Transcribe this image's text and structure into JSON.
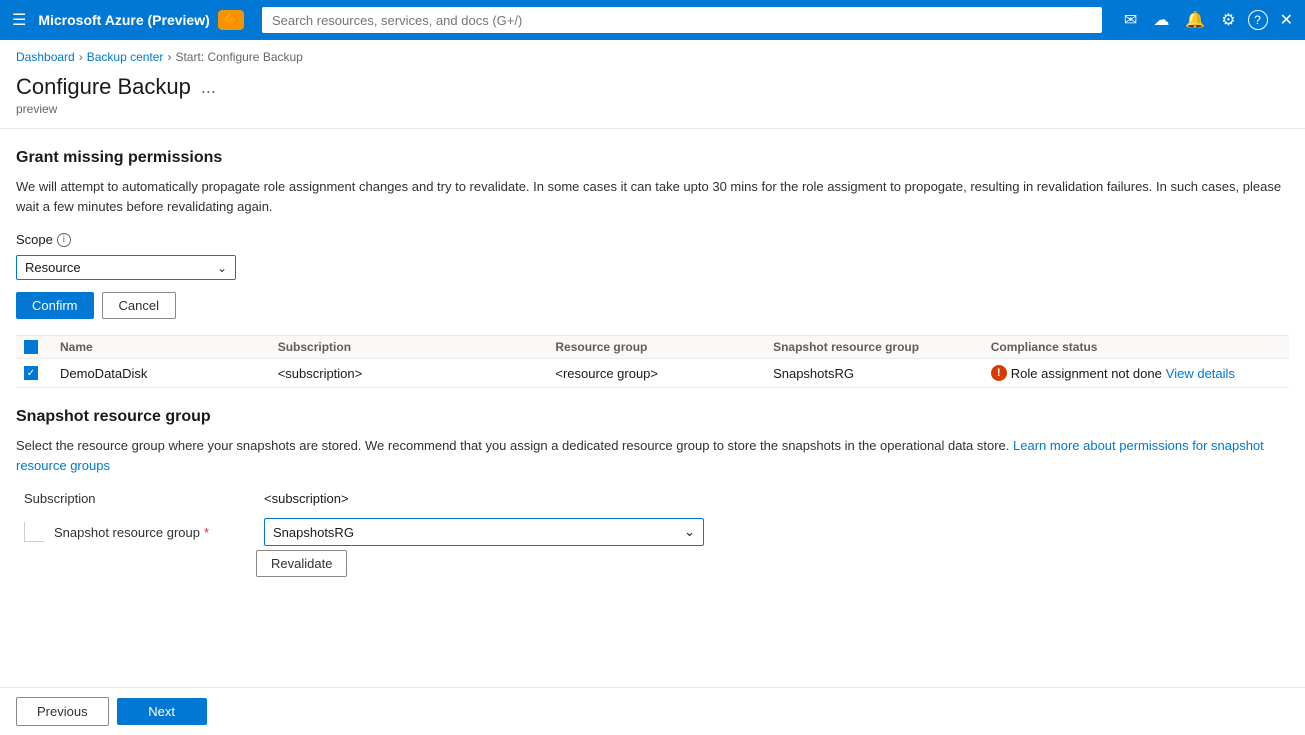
{
  "topbar": {
    "title": "Microsoft Azure (Preview)",
    "badge": "🔔",
    "search_placeholder": "Search resources, services, and docs (G+/)"
  },
  "breadcrumb": {
    "items": [
      "Dashboard",
      "Backup center",
      "Start: Configure Backup"
    ]
  },
  "page": {
    "title": "Configure Backup",
    "subtitle": "preview",
    "more_icon": "..."
  },
  "grant_section": {
    "heading": "Grant missing permissions",
    "description": "We will attempt to automatically propagate role assignment changes and try to revalidate. In some cases it can take upto 30 mins for the role assigment to propogate, resulting in revalidation failures. In such cases, please wait a few minutes before revalidating again.",
    "scope_label": "Scope",
    "scope_value": "Resource",
    "confirm_label": "Confirm",
    "cancel_label": "Cancel"
  },
  "table": {
    "headers": [
      "Name",
      "Subscription",
      "",
      "Resource group",
      "Snapshot resource group",
      "Compliance status"
    ],
    "rows": [
      {
        "checked": true,
        "name": "DemoDataDisk",
        "subscription": "<subscription>",
        "blank": "",
        "resource_group": "<resource group>",
        "snapshot_rg": "SnapshotsRG",
        "status": "Role assignment not done",
        "view_details": "View details"
      }
    ]
  },
  "snapshot_section": {
    "heading": "Snapshot resource group",
    "description_part1": "Select the resource group where your snapshots are stored. We recommend that you assign a dedicated resource group to store the snapshots in the operational data store.",
    "learn_more_text": "Learn more about permissions for snapshot resource groups",
    "learn_more_href": "#",
    "subscription_label": "Subscription",
    "subscription_value": "<subscription>",
    "snapshot_rg_label": "Snapshot resource group",
    "snapshot_rg_value": "SnapshotsRG",
    "revalidate_label": "Revalidate"
  },
  "bottom_nav": {
    "previous_label": "Previous",
    "next_label": "Next"
  },
  "icons": {
    "hamburger": "☰",
    "search": "🔍",
    "email": "✉",
    "cloud": "☁",
    "bell": "🔔",
    "gear": "⚙",
    "help": "?",
    "close": "✕",
    "chevron_down": "⌄",
    "info": "i",
    "check": "✓",
    "error": "!"
  }
}
